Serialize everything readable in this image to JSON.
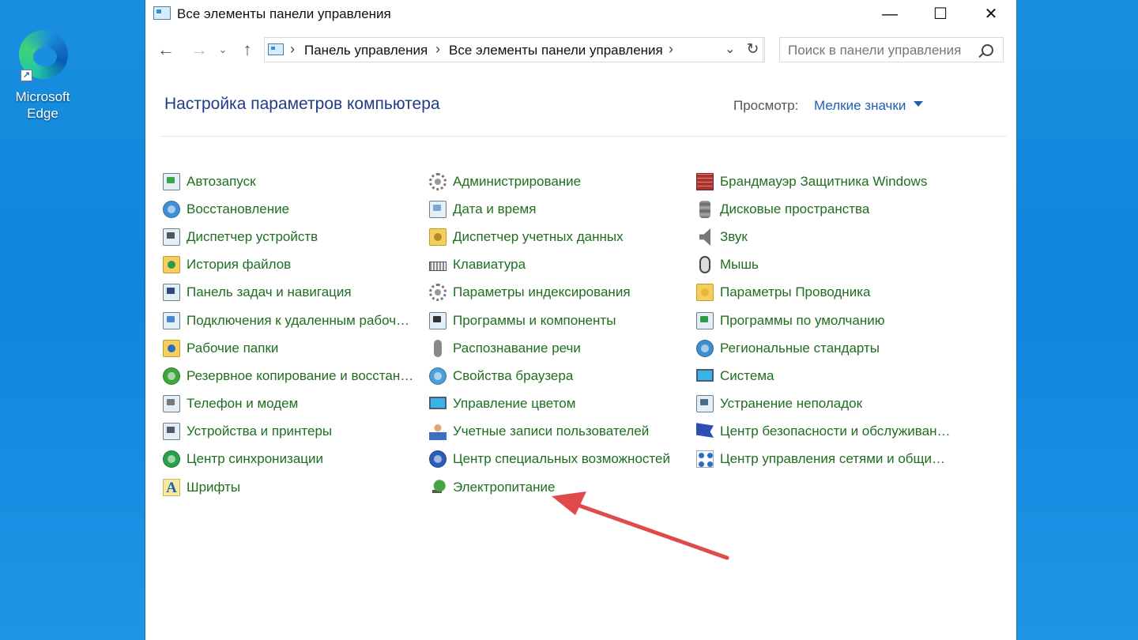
{
  "desktop": {
    "icon_label": "Microsoft Edge",
    "icon_name": "edge-icon"
  },
  "window": {
    "title": "Все элементы панели управления",
    "controls": {
      "minimize": "—",
      "maximize": "☐",
      "close": "✕"
    }
  },
  "nav": {
    "back": "←",
    "forward": "→",
    "recent": "⌄",
    "up": "↑",
    "breadcrumbs": [
      "Панель управления",
      "Все элементы панели управления"
    ],
    "search_placeholder": "Поиск в панели управления"
  },
  "header": {
    "title": "Настройка параметров компьютера",
    "view_label": "Просмотр:",
    "view_value": "Мелкие значки"
  },
  "items": {
    "col1": [
      {
        "label": "Автозапуск",
        "icon": "autoplay-icon"
      },
      {
        "label": "Восстановление",
        "icon": "recovery-icon"
      },
      {
        "label": "Диспетчер устройств",
        "icon": "device-manager-icon"
      },
      {
        "label": "История файлов",
        "icon": "file-history-icon"
      },
      {
        "label": "Панель задач и навигация",
        "icon": "taskbar-icon"
      },
      {
        "label": "Подключения к удаленным рабоч…",
        "icon": "remoteapp-icon"
      },
      {
        "label": "Рабочие папки",
        "icon": "work-folders-icon"
      },
      {
        "label": "Резервное копирование и восстан…",
        "icon": "backup-icon"
      },
      {
        "label": "Телефон и модем",
        "icon": "phone-modem-icon"
      },
      {
        "label": "Устройства и принтеры",
        "icon": "devices-printers-icon"
      },
      {
        "label": "Центр синхронизации",
        "icon": "sync-center-icon"
      },
      {
        "label": "Шрифты",
        "icon": "fonts-icon"
      }
    ],
    "col2": [
      {
        "label": "Администрирование",
        "icon": "admin-tools-icon"
      },
      {
        "label": "Дата и время",
        "icon": "date-time-icon"
      },
      {
        "label": "Диспетчер учетных данных",
        "icon": "credential-manager-icon"
      },
      {
        "label": "Клавиатура",
        "icon": "keyboard-icon"
      },
      {
        "label": "Параметры индексирования",
        "icon": "indexing-icon"
      },
      {
        "label": "Программы и компоненты",
        "icon": "programs-icon"
      },
      {
        "label": "Распознавание речи",
        "icon": "speech-icon"
      },
      {
        "label": "Свойства браузера",
        "icon": "internet-options-icon"
      },
      {
        "label": "Управление цветом",
        "icon": "color-management-icon"
      },
      {
        "label": "Учетные записи пользователей",
        "icon": "user-accounts-icon"
      },
      {
        "label": "Центр специальных возможностей",
        "icon": "ease-of-access-icon"
      },
      {
        "label": "Электропитание",
        "icon": "power-options-icon"
      }
    ],
    "col3": [
      {
        "label": "Брандмауэр Защитника Windows",
        "icon": "firewall-icon"
      },
      {
        "label": "Дисковые пространства",
        "icon": "storage-spaces-icon"
      },
      {
        "label": "Звук",
        "icon": "sound-icon"
      },
      {
        "label": "Мышь",
        "icon": "mouse-icon"
      },
      {
        "label": "Параметры Проводника",
        "icon": "explorer-options-icon"
      },
      {
        "label": "Программы по умолчанию",
        "icon": "default-programs-icon"
      },
      {
        "label": "Региональные стандарты",
        "icon": "region-icon"
      },
      {
        "label": "Система",
        "icon": "system-icon"
      },
      {
        "label": "Устранение неполадок",
        "icon": "troubleshooting-icon"
      },
      {
        "label": "Центр безопасности и обслуживан…",
        "icon": "security-maintenance-icon"
      },
      {
        "label": "Центр управления сетями и общи…",
        "icon": "network-center-icon"
      }
    ]
  },
  "colors": {
    "link_green": "#1f6e1f",
    "heading_blue": "#1e3d87",
    "annotation_red": "#e04a4a"
  }
}
